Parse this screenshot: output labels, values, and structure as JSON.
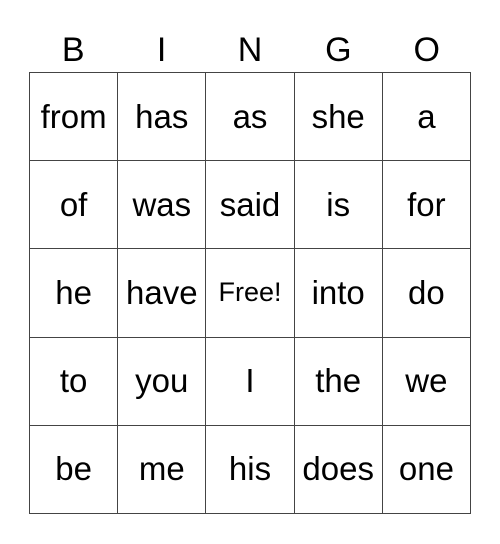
{
  "header": [
    "B",
    "I",
    "N",
    "G",
    "O"
  ],
  "rows": [
    [
      "from",
      "has",
      "as",
      "she",
      "a"
    ],
    [
      "of",
      "was",
      "said",
      "is",
      "for"
    ],
    [
      "he",
      "have",
      "Free!",
      "into",
      "do"
    ],
    [
      "to",
      "you",
      "I",
      "the",
      "we"
    ],
    [
      "be",
      "me",
      "his",
      "does",
      "one"
    ]
  ]
}
